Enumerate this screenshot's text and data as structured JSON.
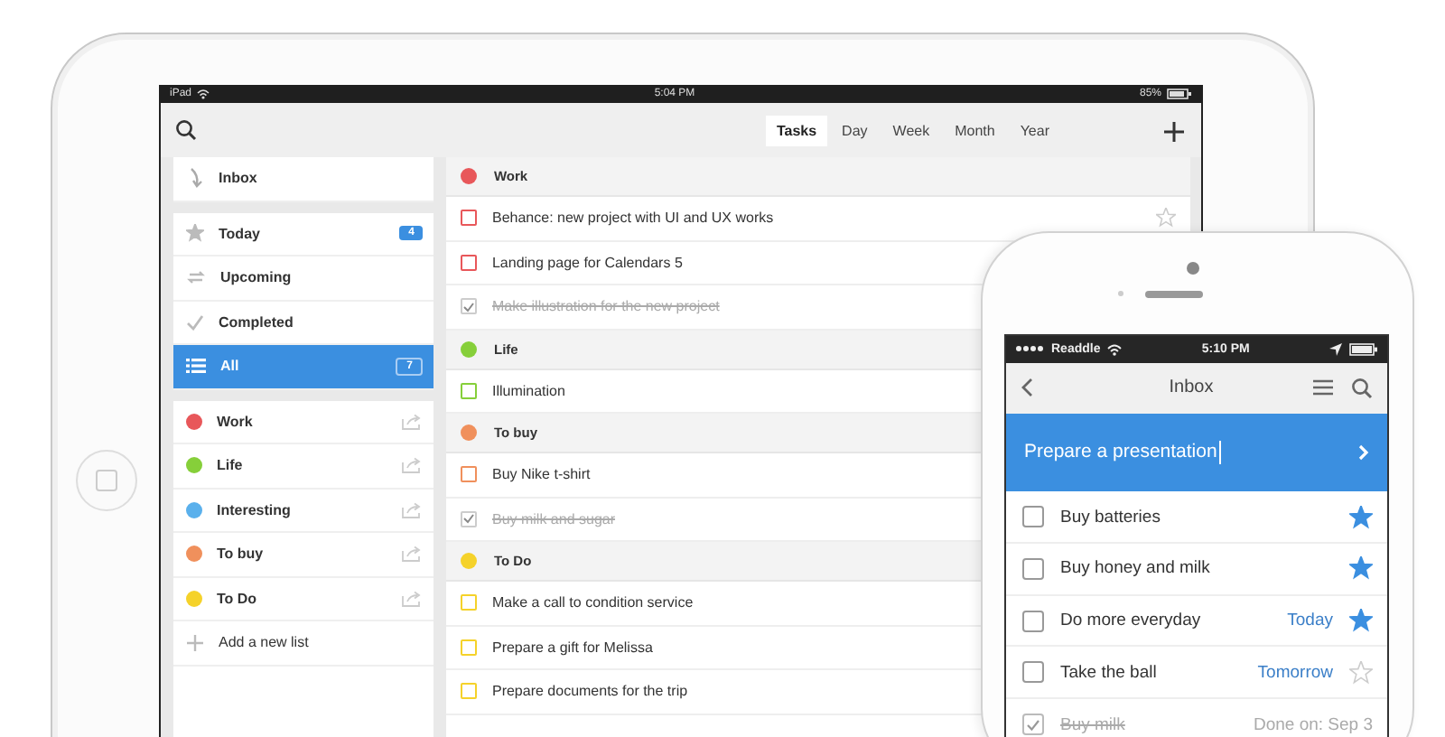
{
  "tablet": {
    "status_bar": {
      "device": "iPad",
      "time": "5:04 PM",
      "battery": "85%"
    },
    "toolbar": {
      "tabs": [
        {
          "label": "Tasks",
          "selected": true
        },
        {
          "label": "Day",
          "selected": false
        },
        {
          "label": "Week",
          "selected": false
        },
        {
          "label": "Month",
          "selected": false
        },
        {
          "label": "Year",
          "selected": false
        }
      ]
    },
    "sidebar": {
      "inbox": {
        "label": "Inbox",
        "selected": false
      },
      "filters": [
        {
          "kind": "star",
          "label": "Today",
          "count": "4",
          "selected": false
        },
        {
          "kind": "repeat",
          "label": "Upcoming",
          "selected": false
        },
        {
          "kind": "check",
          "label": "Completed",
          "selected": false
        },
        {
          "kind": "list",
          "label": "All",
          "count": "7",
          "selected": true
        }
      ],
      "lists": [
        {
          "label": "Work",
          "color": "#e8575a"
        },
        {
          "label": "Life",
          "color": "#86cf3a"
        },
        {
          "label": "Interesting",
          "color": "#5ab0ec"
        },
        {
          "label": "To buy",
          "color": "#f0905c"
        },
        {
          "label": "To Do",
          "color": "#f5d22a"
        }
      ],
      "add_list": "Add a new list"
    },
    "groups": [
      {
        "title": "Work",
        "color": "#e8575a",
        "items": [
          {
            "text": "Behance: new project with UI and UX works",
            "checked": false,
            "starred": false
          },
          {
            "text": "Landing page for Calendars 5",
            "checked": false
          },
          {
            "text": "Make illustration for the new project",
            "checked": true
          }
        ]
      },
      {
        "title": "Life",
        "color": "#86cf3a",
        "items": [
          {
            "text": "Illumination",
            "checked": false
          }
        ]
      },
      {
        "title": "To buy",
        "color": "#f0905c",
        "items": [
          {
            "text": "Buy Nike t-shirt",
            "checked": false
          },
          {
            "text": "Buy milk and sugar",
            "checked": true
          }
        ]
      },
      {
        "title": "To Do",
        "color": "#f5d22a",
        "items": [
          {
            "text": "Make a call to condition service",
            "checked": false
          },
          {
            "text": "Prepare a gift for Melissa",
            "checked": false
          },
          {
            "text": "Prepare documents for the trip",
            "checked": false
          }
        ]
      }
    ]
  },
  "phone": {
    "status_bar": {
      "carrier": "Readdle",
      "time": "5:10 PM"
    },
    "nav": {
      "title": "Inbox"
    },
    "new_task": {
      "value": "Prepare a presentation"
    },
    "tasks": [
      {
        "text": "Buy batteries",
        "checked": false,
        "starred": true
      },
      {
        "text": "Buy honey and milk",
        "checked": false,
        "starred": true
      },
      {
        "text": "Do more everyday",
        "due": "Today",
        "checked": false,
        "starred": true
      },
      {
        "text": "Take the ball",
        "due": "Tomorrow",
        "checked": false,
        "starred": false
      },
      {
        "text": "Buy milk",
        "done_on": "Done on: Sep 3",
        "checked": true
      }
    ]
  }
}
